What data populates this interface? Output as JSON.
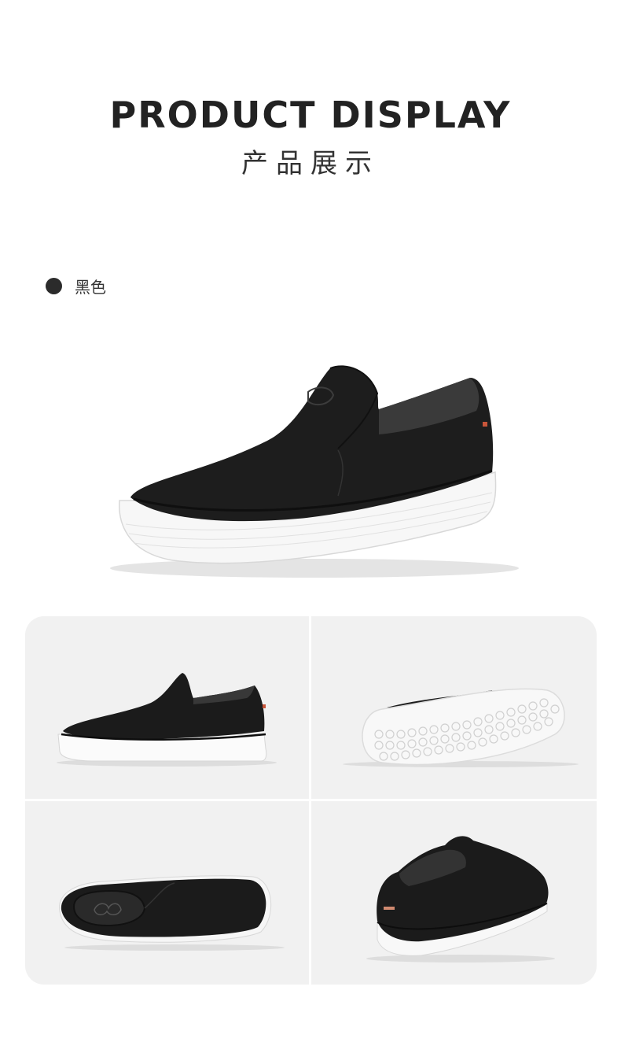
{
  "header": {
    "title_en": "PRODUCT DISPLAY",
    "title_cn": "产品展示"
  },
  "color_option": {
    "name": "黑色",
    "swatch_color": "#2b2b2b"
  },
  "images": {
    "hero": "shoe-three-quarter-view",
    "grid": [
      "shoe-side-view",
      "shoe-sole-view",
      "shoe-top-view",
      "shoe-rear-view"
    ]
  }
}
